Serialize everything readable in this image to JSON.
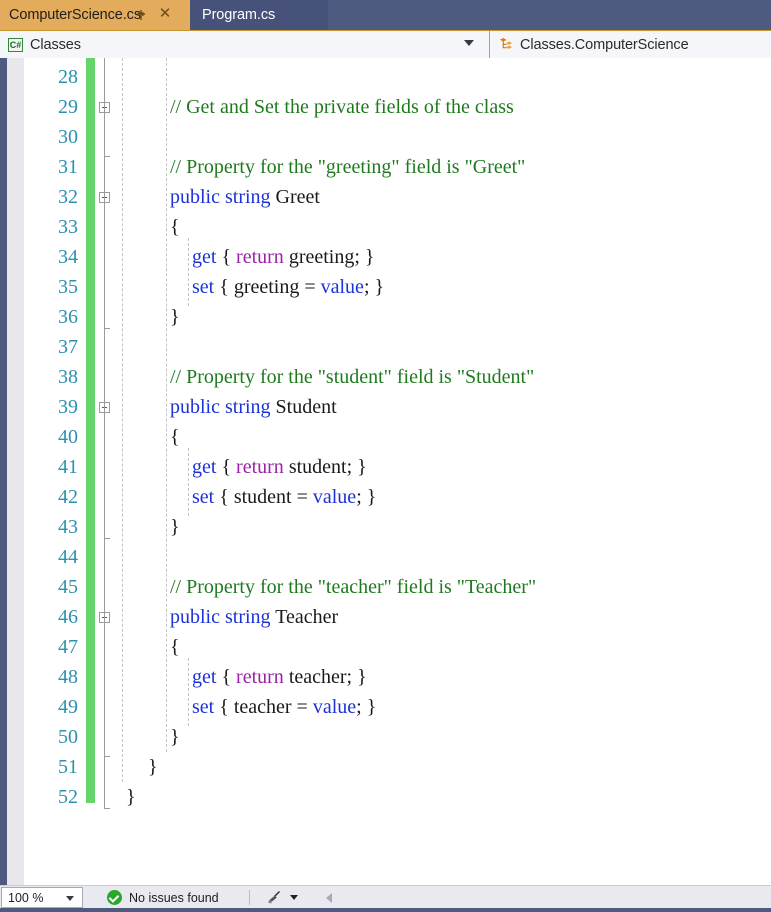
{
  "window": {
    "accent_blue": "#4e5a80",
    "active_tab_bg": "#e3ac5d"
  },
  "tabs": [
    {
      "label": "ComputerScience.cs",
      "active": true,
      "pin_icon": "pin-icon",
      "close_icon": "close-icon"
    },
    {
      "label": "Program.cs",
      "active": false
    }
  ],
  "nav_bar": {
    "left_icon": "csharp-file-icon",
    "left_icon_text": "C#",
    "left_label": "Classes",
    "dropdown_icon": "chevron-down-icon",
    "right_icon": "class-member-icon",
    "right_label": "Classes.ComputerScience"
  },
  "editor": {
    "first_line_number": 28,
    "line_height": 30,
    "colors": {
      "comment": "#1f7a1f",
      "keyword": "#1b32d8",
      "control_keyword": "#9b22a8",
      "identifier": "#1a1a1a",
      "line_number": "#2b91af",
      "change_bar": "#65d46b"
    },
    "lines": [
      {
        "n": 28,
        "indent": 0,
        "fold": null,
        "tokens": []
      },
      {
        "n": 29,
        "indent": 2,
        "fold": "open",
        "tokens": [
          {
            "t": "cm",
            "s": "// Get and Set the private fields of the class"
          }
        ]
      },
      {
        "n": 30,
        "indent": 0,
        "fold": null,
        "tokens": []
      },
      {
        "n": 31,
        "indent": 2,
        "fold": null,
        "tokens": [
          {
            "t": "cm",
            "s": "// Property for the \"greeting\" field is \"Greet\""
          }
        ]
      },
      {
        "n": 32,
        "indent": 2,
        "fold": "open",
        "tokens": [
          {
            "t": "kw",
            "s": "public string "
          },
          {
            "t": "id",
            "s": "Greet"
          }
        ]
      },
      {
        "n": 33,
        "indent": 2,
        "fold": null,
        "tokens": [
          {
            "t": "id",
            "s": "{"
          }
        ]
      },
      {
        "n": 34,
        "indent": 3,
        "fold": null,
        "tokens": [
          {
            "t": "kw",
            "s": "get"
          },
          {
            "t": "id",
            "s": " { "
          },
          {
            "t": "ctl",
            "s": "return"
          },
          {
            "t": "id",
            "s": " greeting; }"
          }
        ]
      },
      {
        "n": 35,
        "indent": 3,
        "fold": null,
        "tokens": [
          {
            "t": "kw",
            "s": "set"
          },
          {
            "t": "id",
            "s": " { greeting = "
          },
          {
            "t": "kw",
            "s": "value"
          },
          {
            "t": "id",
            "s": "; }"
          }
        ]
      },
      {
        "n": 36,
        "indent": 2,
        "fold": null,
        "tokens": [
          {
            "t": "id",
            "s": "}"
          }
        ]
      },
      {
        "n": 37,
        "indent": 0,
        "fold": null,
        "tokens": []
      },
      {
        "n": 38,
        "indent": 2,
        "fold": null,
        "tokens": [
          {
            "t": "cm",
            "s": "// Property for the \"student\" field is \"Student\""
          }
        ]
      },
      {
        "n": 39,
        "indent": 2,
        "fold": "open",
        "tokens": [
          {
            "t": "kw",
            "s": "public string "
          },
          {
            "t": "id",
            "s": "Student"
          }
        ]
      },
      {
        "n": 40,
        "indent": 2,
        "fold": null,
        "tokens": [
          {
            "t": "id",
            "s": "{"
          }
        ]
      },
      {
        "n": 41,
        "indent": 3,
        "fold": null,
        "tokens": [
          {
            "t": "kw",
            "s": "get"
          },
          {
            "t": "id",
            "s": " { "
          },
          {
            "t": "ctl",
            "s": "return"
          },
          {
            "t": "id",
            "s": " student; }"
          }
        ]
      },
      {
        "n": 42,
        "indent": 3,
        "fold": null,
        "tokens": [
          {
            "t": "kw",
            "s": "set"
          },
          {
            "t": "id",
            "s": " { student = "
          },
          {
            "t": "kw",
            "s": "value"
          },
          {
            "t": "id",
            "s": "; }"
          }
        ]
      },
      {
        "n": 43,
        "indent": 2,
        "fold": null,
        "tokens": [
          {
            "t": "id",
            "s": "}"
          }
        ]
      },
      {
        "n": 44,
        "indent": 0,
        "fold": null,
        "tokens": []
      },
      {
        "n": 45,
        "indent": 2,
        "fold": null,
        "tokens": [
          {
            "t": "cm",
            "s": "// Property for the \"teacher\" field is \"Teacher\""
          }
        ]
      },
      {
        "n": 46,
        "indent": 2,
        "fold": "open",
        "tokens": [
          {
            "t": "kw",
            "s": "public string "
          },
          {
            "t": "id",
            "s": "Teacher"
          }
        ]
      },
      {
        "n": 47,
        "indent": 2,
        "fold": null,
        "tokens": [
          {
            "t": "id",
            "s": "{"
          }
        ]
      },
      {
        "n": 48,
        "indent": 3,
        "fold": null,
        "tokens": [
          {
            "t": "kw",
            "s": "get"
          },
          {
            "t": "id",
            "s": " { "
          },
          {
            "t": "ctl",
            "s": "return"
          },
          {
            "t": "id",
            "s": " teacher; }"
          }
        ]
      },
      {
        "n": 49,
        "indent": 3,
        "fold": null,
        "tokens": [
          {
            "t": "kw",
            "s": "set"
          },
          {
            "t": "id",
            "s": " { teacher = "
          },
          {
            "t": "kw",
            "s": "value"
          },
          {
            "t": "id",
            "s": "; }"
          }
        ]
      },
      {
        "n": 50,
        "indent": 2,
        "fold": null,
        "tokens": [
          {
            "t": "id",
            "s": "}"
          }
        ]
      },
      {
        "n": 51,
        "indent": 1,
        "fold": null,
        "tokens": [
          {
            "t": "id",
            "s": "}"
          }
        ]
      },
      {
        "n": 52,
        "indent": 0,
        "fold": null,
        "tokens": [
          {
            "t": "id",
            "s": "}"
          }
        ]
      }
    ]
  },
  "status_bar": {
    "zoom_value": "100 %",
    "zoom_caret_icon": "chevron-down-icon",
    "issues_icon": "check-circle-icon",
    "issues_text": "No issues found",
    "broom_icon": "broom-icon",
    "broom_caret_icon": "chevron-down-icon",
    "back_icon": "chevron-left-icon"
  }
}
